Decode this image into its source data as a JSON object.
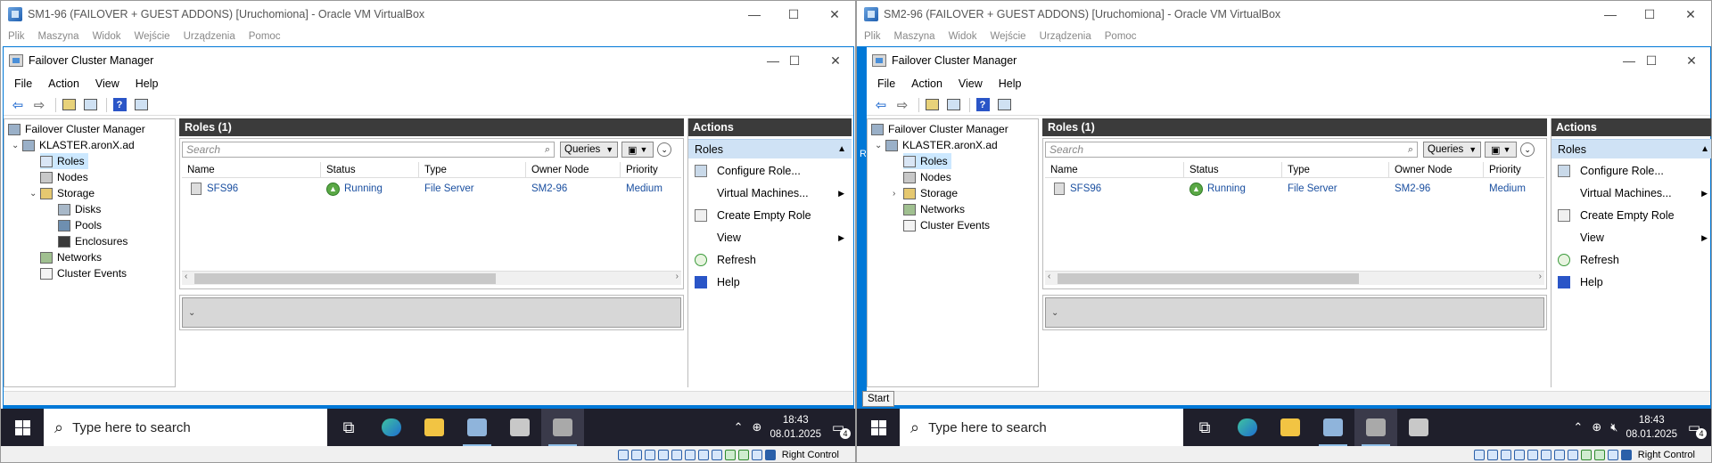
{
  "vms": [
    {
      "vb_title": "SM1-96 (FAILOVER + GUEST ADDONS) [Uruchomiona] - Oracle VM VirtualBox",
      "vb_menu": [
        "Plik",
        "Maszyna",
        "Widok",
        "Wejście",
        "Urządzenia",
        "Pomoc"
      ],
      "fcm_title": "Failover Cluster Manager",
      "fcm_menu": [
        "File",
        "Action",
        "View",
        "Help"
      ],
      "tree": {
        "root": "Failover Cluster Manager",
        "cluster": "KLASTER.aronX.ad",
        "roles": "Roles",
        "nodes": "Nodes",
        "storage": "Storage",
        "disks": "Disks",
        "pools": "Pools",
        "enclosures": "Enclosures",
        "networks": "Networks",
        "events": "Cluster Events"
      },
      "roles_header": "Roles (1)",
      "search_placeholder": "Search",
      "queries_label": "Queries",
      "columns": [
        "Name",
        "Status",
        "Type",
        "Owner Node",
        "Priority"
      ],
      "row": {
        "name": "SFS96",
        "status": "Running",
        "type": "File Server",
        "owner": "SM2-96",
        "priority": "Medium"
      },
      "actions_header": "Actions",
      "actions_sub": "Roles",
      "actions": [
        "Configure Role...",
        "Virtual Machines...",
        "Create Empty Role",
        "View",
        "Refresh",
        "Help"
      ],
      "taskbar_search": "Type here to search",
      "clock_time": "18:43",
      "clock_date": "08.01.2025",
      "notif_count": "4",
      "right_control": "Right Control"
    },
    {
      "vb_title": "SM2-96 (FAILOVER + GUEST ADDONS) [Uruchomiona] - Oracle VM VirtualBox",
      "vb_menu": [
        "Plik",
        "Maszyna",
        "Widok",
        "Wejście",
        "Urządzenia",
        "Pomoc"
      ],
      "fcm_title": "Failover Cluster Manager",
      "fcm_menu": [
        "File",
        "Action",
        "View",
        "Help"
      ],
      "tree": {
        "root": "Failover Cluster Manager",
        "cluster": "KLASTER.aronX.ad",
        "roles": "Roles",
        "nodes": "Nodes",
        "storage": "Storage",
        "networks": "Networks",
        "events": "Cluster Events"
      },
      "roles_header": "Roles (1)",
      "search_placeholder": "Search",
      "queries_label": "Queries",
      "columns": [
        "Name",
        "Status",
        "Type",
        "Owner Node",
        "Priority"
      ],
      "row": {
        "name": "SFS96",
        "status": "Running",
        "type": "File Server",
        "owner": "SM2-96",
        "priority": "Medium"
      },
      "actions_header": "Actions",
      "actions_sub": "Roles",
      "actions": [
        "Configure Role...",
        "Virtual Machines...",
        "Create Empty Role",
        "View",
        "Refresh",
        "Help"
      ],
      "taskbar_search": "Type here to search",
      "clock_time": "18:43",
      "clock_date": "08.01.2025",
      "notif_count": "4",
      "right_control": "Right Control",
      "tooltip": "Start",
      "edge_letter": "R"
    }
  ]
}
